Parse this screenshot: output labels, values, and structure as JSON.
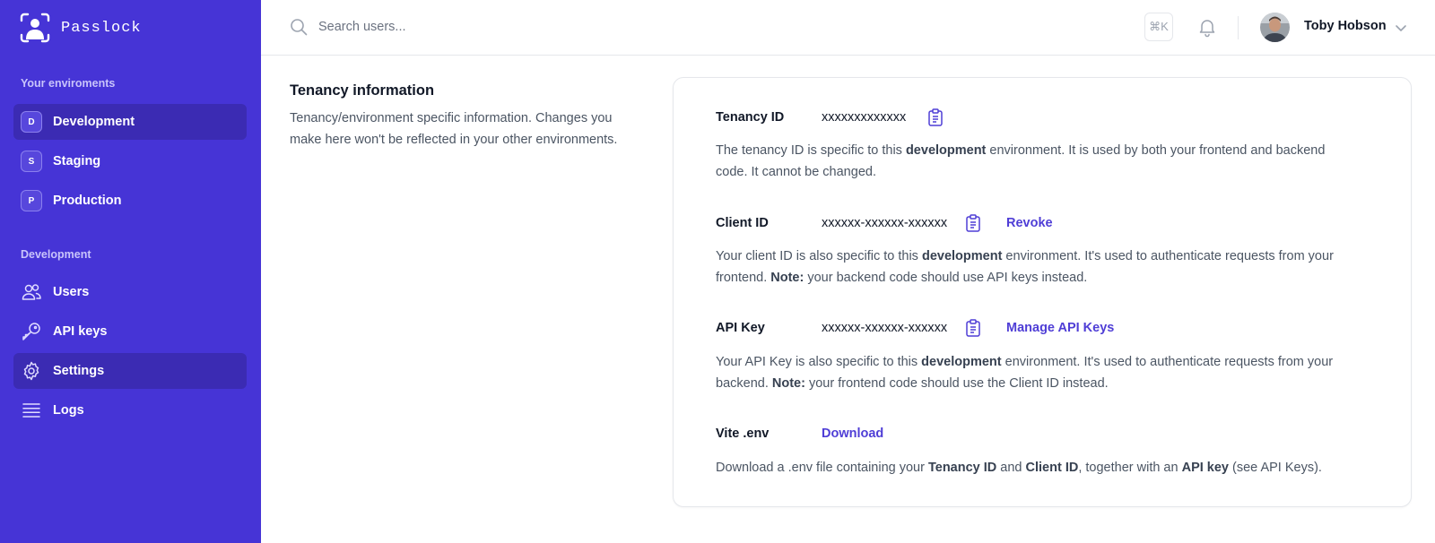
{
  "brand": {
    "name": "Passlock"
  },
  "sidebar": {
    "env_heading": "Your enviroments",
    "environments": [
      {
        "badge": "D",
        "label": "Development",
        "active": true
      },
      {
        "badge": "S",
        "label": "Staging",
        "active": false
      },
      {
        "badge": "P",
        "label": "Production",
        "active": false
      }
    ],
    "section_heading": "Development",
    "nav": [
      {
        "icon": "users-icon",
        "label": "Users",
        "active": false
      },
      {
        "icon": "key-icon",
        "label": "API keys",
        "active": false
      },
      {
        "icon": "gear-icon",
        "label": "Settings",
        "active": true
      },
      {
        "icon": "list-icon",
        "label": "Logs",
        "active": false
      }
    ]
  },
  "topbar": {
    "search_placeholder": "Search users...",
    "shortcut": "⌘K",
    "user_name": "Toby Hobson"
  },
  "main": {
    "section_title": "Tenancy information",
    "section_desc": "Tenancy/environment specific information. Changes you make here won't be reflected in your other environments.",
    "tenancy": {
      "label": "Tenancy ID",
      "value": "xxxxxxxxxxxxx",
      "help_1": "The tenancy ID is specific to this ",
      "help_bold": "development",
      "help_2": " environment. It is used by both your frontend and backend code. It cannot be changed."
    },
    "client": {
      "label": "Client ID",
      "value": "xxxxxx-xxxxxx-xxxxxx",
      "link": "Revoke",
      "help_1": "Your client ID is also specific to this ",
      "help_bold": "development",
      "help_2": " environment. It's used to authenticate requests from your frontend. ",
      "help_note": "Note:",
      "help_3": " your backend code should use API keys instead."
    },
    "api_key": {
      "label": "API Key",
      "value": "xxxxxx-xxxxxx-xxxxxx",
      "link": "Manage API Keys",
      "help_1": "Your API Key is also specific to this ",
      "help_bold": "development",
      "help_2": " environment. It's used to authenticate requests from your backend. ",
      "help_note": "Note:",
      "help_3": " your frontend code should use the Client ID instead."
    },
    "vite": {
      "label": "Vite .env",
      "link": "Download",
      "help_1": "Download a .env file containing your ",
      "help_bold_1": "Tenancy ID",
      "help_2": " and ",
      "help_bold_2": "Client ID",
      "help_3": ", together with an ",
      "help_bold_3": "API key",
      "help_4": " (see API Keys)."
    }
  }
}
